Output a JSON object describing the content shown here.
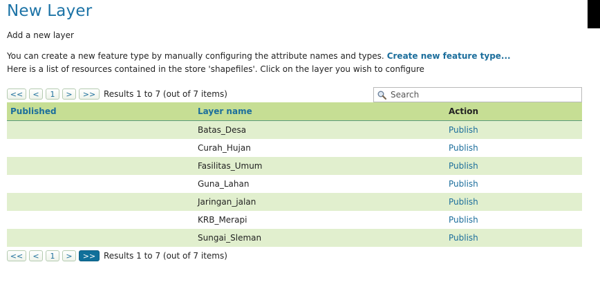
{
  "page": {
    "title": "New Layer",
    "subtitle": "Add a new layer",
    "description_line1": "You can create a new feature type by manually configuring the attribute names and types.",
    "create_link": "Create new feature type...",
    "description_line2": "Here is a list of resources contained in the store 'shapefiles'. Click on the layer you wish to configure"
  },
  "pager": {
    "first": "<<",
    "prev": "<",
    "page": "1",
    "next": ">",
    "last": ">>",
    "results": "Results 1 to 7 (out of 7 items)"
  },
  "search": {
    "placeholder": "Search",
    "value": ""
  },
  "table": {
    "columns": [
      "Published",
      "Layer name",
      "Action"
    ],
    "rows": [
      {
        "published": "",
        "name": "Batas_Desa",
        "action": "Publish"
      },
      {
        "published": "",
        "name": "Curah_Hujan",
        "action": "Publish"
      },
      {
        "published": "",
        "name": "Fasilitas_Umum",
        "action": "Publish"
      },
      {
        "published": "",
        "name": "Guna_Lahan",
        "action": "Publish"
      },
      {
        "published": "",
        "name": "Jaringan_jalan",
        "action": "Publish"
      },
      {
        "published": "",
        "name": "KRB_Merapi",
        "action": "Publish"
      },
      {
        "published": "",
        "name": "Sungai_Sleman",
        "action": "Publish"
      }
    ]
  },
  "colors": {
    "title": "#1c73a6",
    "link": "#1c6e9c",
    "header_bg": "#c6de94",
    "row_alt_bg": "#e1efce",
    "active_page_bg": "#10709a"
  }
}
